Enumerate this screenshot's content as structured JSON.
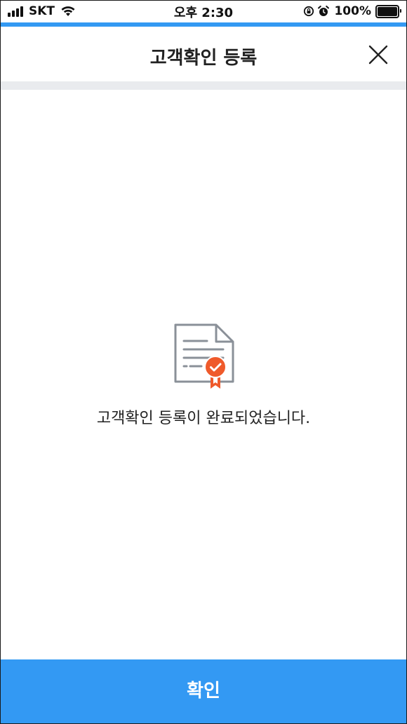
{
  "status_bar": {
    "carrier": "SKT",
    "time": "오후 2:30",
    "battery": "100%"
  },
  "header": {
    "title": "고객확인 등록"
  },
  "content": {
    "message": "고객확인 등록이 완료되었습니다."
  },
  "footer": {
    "confirm_label": "확인"
  },
  "colors": {
    "accent": "#3399f3",
    "icon_gray": "#8a9098",
    "badge_orange": "#ef5a2b",
    "divider": "#e9ebee"
  },
  "icons": {
    "close": "close-icon",
    "certificate": "certificate-icon"
  }
}
